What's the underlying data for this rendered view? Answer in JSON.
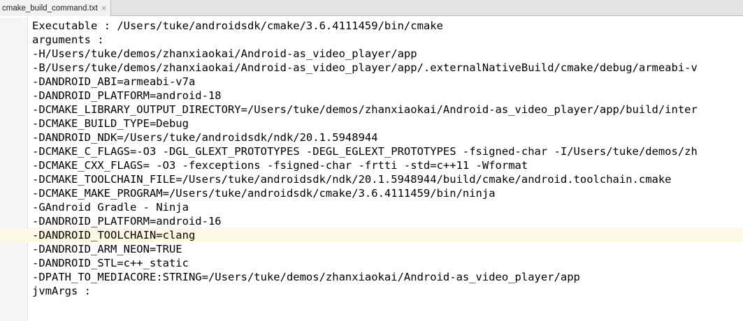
{
  "tab": {
    "filename": "cmake_build_command.txt",
    "close_glyph": "×"
  },
  "editor": {
    "current_line_index": 15,
    "current_line_color": "#fdf8e3",
    "lines": [
      "Executable : /Users/tuke/androidsdk/cmake/3.6.4111459/bin/cmake",
      "arguments :",
      "-H/Users/tuke/demos/zhanxiaokai/Android-as_video_player/app",
      "-B/Users/tuke/demos/zhanxiaokai/Android-as_video_player/app/.externalNativeBuild/cmake/debug/armeabi-v",
      "-DANDROID_ABI=armeabi-v7a",
      "-DANDROID_PLATFORM=android-18",
      "-DCMAKE_LIBRARY_OUTPUT_DIRECTORY=/Users/tuke/demos/zhanxiaokai/Android-as_video_player/app/build/inter",
      "-DCMAKE_BUILD_TYPE=Debug",
      "-DANDROID_NDK=/Users/tuke/androidsdk/ndk/20.1.5948944",
      "-DCMAKE_C_FLAGS=-O3 -DGL_GLEXT_PROTOTYPES -DEGL_EGLEXT_PROTOTYPES -fsigned-char -I/Users/tuke/demos/zh",
      "-DCMAKE_CXX_FLAGS= -O3 -fexceptions -fsigned-char -frtti -std=c++11 -Wformat",
      "-DCMAKE_TOOLCHAIN_FILE=/Users/tuke/androidsdk/ndk/20.1.5948944/build/cmake/android.toolchain.cmake",
      "-DCMAKE_MAKE_PROGRAM=/Users/tuke/androidsdk/cmake/3.6.4111459/bin/ninja",
      "-GAndroid Gradle - Ninja",
      "-DANDROID_PLATFORM=android-16",
      "-DANDROID_TOOLCHAIN=clang",
      "-DANDROID_ARM_NEON=TRUE",
      "-DANDROID_STL=c++_static",
      "-DPATH_TO_MEDIACORE:STRING=/Users/tuke/demos/zhanxiaokai/Android-as_video_player/app",
      "jvmArgs :"
    ]
  }
}
